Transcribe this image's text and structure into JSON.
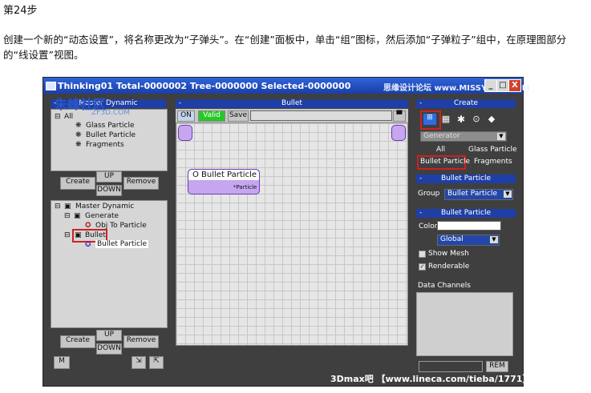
{
  "doc": {
    "title": "第24步",
    "description": "创建一个新的“动态设置”，将名称更改为“子弹头”。在“创建”面板中，单击“组”图标，然后添加“子弹粒子”组中，在原理图部分的“线设置”视图。"
  },
  "window": {
    "title": "Thinking01  Total-0000002  Tree-0000000  Selected-0000000",
    "watermark_top": "思缘设计论坛  www.MISSYUAN.COM",
    "watermark_logo": "朱峰社区",
    "watermark_logo_sub": "ZF3D.COM",
    "watermark_bottom": "3Dmax吧 【www.lineca.com/tieba/1771】",
    "min": "_",
    "max": "□",
    "close": "X"
  },
  "left_top": {
    "header": "Master Dynamic",
    "root": "All",
    "items": [
      "Glass Particle",
      "Bullet Particle",
      "Fragments"
    ]
  },
  "left_buttons": {
    "create": "Create",
    "up": "UP",
    "down": "DOWN",
    "remove": "Remove"
  },
  "left_bottom": {
    "root": "Master Dynamic",
    "generate": "Generate",
    "obj_to_particle": "Obj To Particle",
    "bullet": "Bullet",
    "bullet_particle": "Bullet Particle"
  },
  "left_bottom_buttons": {
    "create": "Create",
    "up": "UP",
    "down": "DOWN",
    "remove": "Remove",
    "m": "M"
  },
  "center": {
    "header": "Bullet",
    "on": "ON",
    "valid": "Valid",
    "save": "Save",
    "node_title": "O Bullet Particle",
    "node_sub": "*Particle"
  },
  "right": {
    "create_header": "Create",
    "generator": "Generator",
    "all": "All",
    "glass_particle": "Glass Particle",
    "bullet_particle": "Bullet Particle",
    "fragments": "Fragments",
    "section1": "Bullet Particle",
    "group_label": "Group",
    "group_value": "Bullet Particle",
    "section2": "Bullet Particle",
    "color_label": "Color",
    "global": "Global",
    "show_mesh": "Show Mesh",
    "renderable": "Renderable",
    "data_channels": "Data Channels",
    "rem": "REM"
  }
}
